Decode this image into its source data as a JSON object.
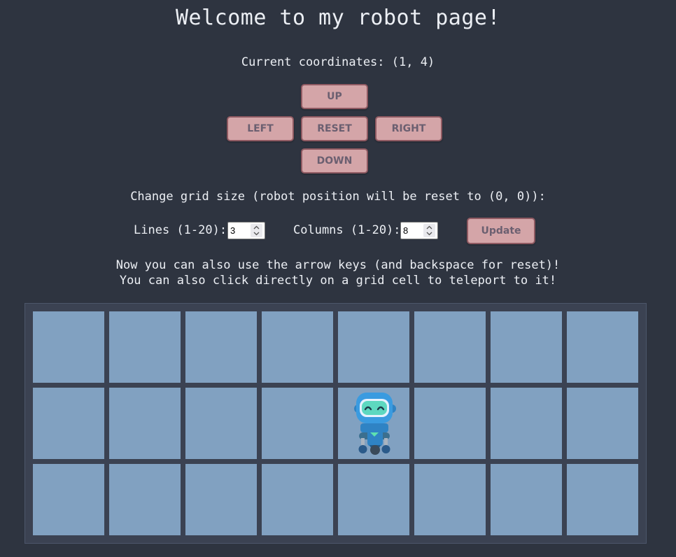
{
  "title": "Welcome to my robot page!",
  "coordinates_text": "Current coordinates: (1, 4)",
  "controls": {
    "up": "UP",
    "left": "LEFT",
    "reset": "RESET",
    "right": "RIGHT",
    "down": "DOWN"
  },
  "grid_size": {
    "instruction": "Change grid size (robot position will be reset to (0, 0)):",
    "lines_label": "Lines (1-20):",
    "lines_value": "3",
    "columns_label": "Columns (1-20):",
    "columns_value": "8",
    "update_label": "Update"
  },
  "notes": {
    "line1": "Now you can also use the arrow keys (and backspace for reset)!",
    "line2": "You can also click directly on a grid cell to teleport to it!"
  },
  "grid": {
    "rows": 3,
    "columns": 8,
    "robot_row": 1,
    "robot_col": 4
  },
  "colors": {
    "background": "#2e3440",
    "button": "#d4a5a8",
    "cell": "#81a1c1",
    "board": "#3b4252"
  }
}
